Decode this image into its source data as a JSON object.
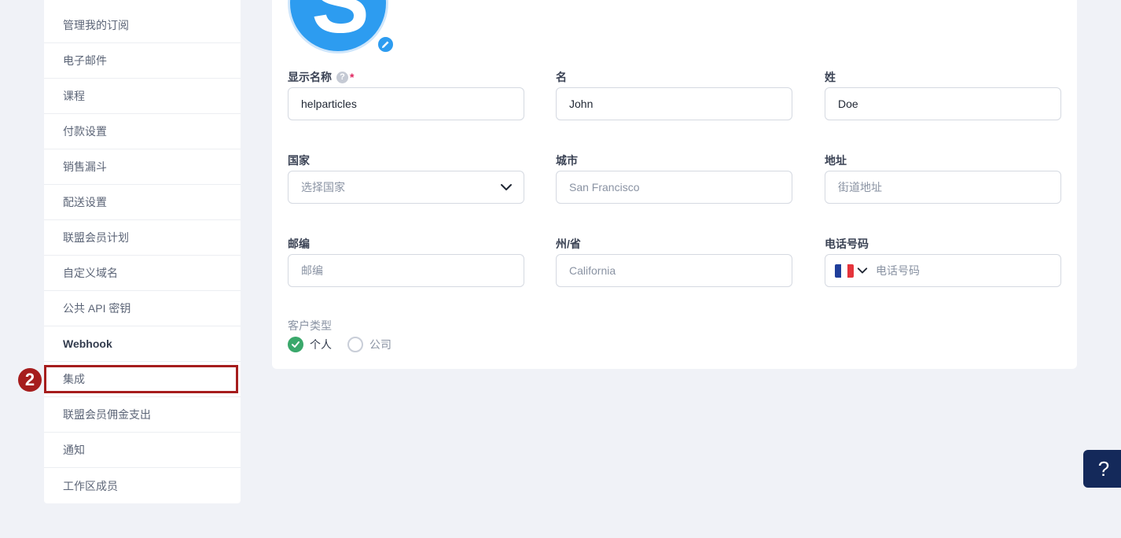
{
  "sidebar": {
    "items": [
      {
        "label": "管理我的订阅"
      },
      {
        "label": "电子邮件"
      },
      {
        "label": "课程"
      },
      {
        "label": "付款设置"
      },
      {
        "label": "销售漏斗"
      },
      {
        "label": "配送设置"
      },
      {
        "label": "联盟会员计划"
      },
      {
        "label": "自定义域名"
      },
      {
        "label": "公共 API 密钥"
      },
      {
        "label": "Webhook"
      },
      {
        "label": "集成"
      },
      {
        "label": "联盟会员佣金支出"
      },
      {
        "label": "通知"
      },
      {
        "label": "工作区成员"
      }
    ]
  },
  "annotation": {
    "step": "2",
    "color": "#a61d1d"
  },
  "avatar": {
    "letter": "S",
    "color": "#2d9cf0"
  },
  "form": {
    "display_name": {
      "label": "显示名称",
      "required_mark": "*",
      "help": "?",
      "value": "helparticles"
    },
    "first_name": {
      "label": "名",
      "value": "John"
    },
    "last_name": {
      "label": "姓",
      "value": "Doe"
    },
    "country": {
      "label": "国家",
      "placeholder": "选择国家"
    },
    "city": {
      "label": "城市",
      "placeholder": "San Francisco"
    },
    "address": {
      "label": "地址",
      "placeholder": "街道地址"
    },
    "zip": {
      "label": "邮编",
      "placeholder": "邮编"
    },
    "state": {
      "label": "州/省",
      "placeholder": "California"
    },
    "phone": {
      "label": "电话号码",
      "placeholder": "电话号码",
      "flag": "france"
    },
    "customer_type": {
      "label": "客户类型",
      "options": [
        {
          "label": "个人",
          "selected": true
        },
        {
          "label": "公司",
          "selected": false
        }
      ]
    }
  },
  "help_button": {
    "label": "?"
  }
}
